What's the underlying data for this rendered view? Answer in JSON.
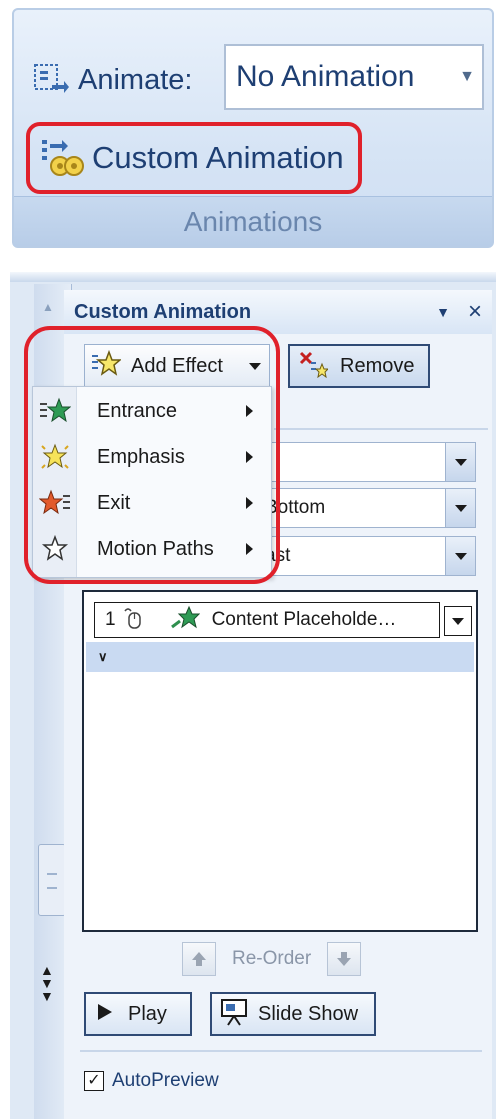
{
  "ribbon": {
    "animate_label": "Animate:",
    "animate_value": "No Animation",
    "custom_animation_label": "Custom Animation",
    "group_label": "Animations"
  },
  "pane": {
    "title": "Custom Animation",
    "add_effect_label": "Add Effect",
    "remove_label": "Remove",
    "combos": [
      {
        "value": ""
      },
      {
        "value": "Bottom"
      },
      {
        "value": "ast"
      }
    ],
    "effect_item": {
      "number": "1",
      "text": "Content Placeholde…"
    },
    "reorder_label": "Re-Order",
    "play_label": "Play",
    "slideshow_label": "Slide Show",
    "autopreview_label": "AutoPreview",
    "autopreview_checked": true
  },
  "add_effect_menu": {
    "items": [
      {
        "label": "Entrance",
        "icon": "entrance-star-icon"
      },
      {
        "label": "Emphasis",
        "icon": "emphasis-star-icon"
      },
      {
        "label": "Exit",
        "icon": "exit-star-icon"
      },
      {
        "label": "Motion Paths",
        "icon": "motion-path-star-icon"
      }
    ]
  },
  "colors": {
    "accent_text": "#1e3f73",
    "highlight_ring": "#e0212b"
  }
}
